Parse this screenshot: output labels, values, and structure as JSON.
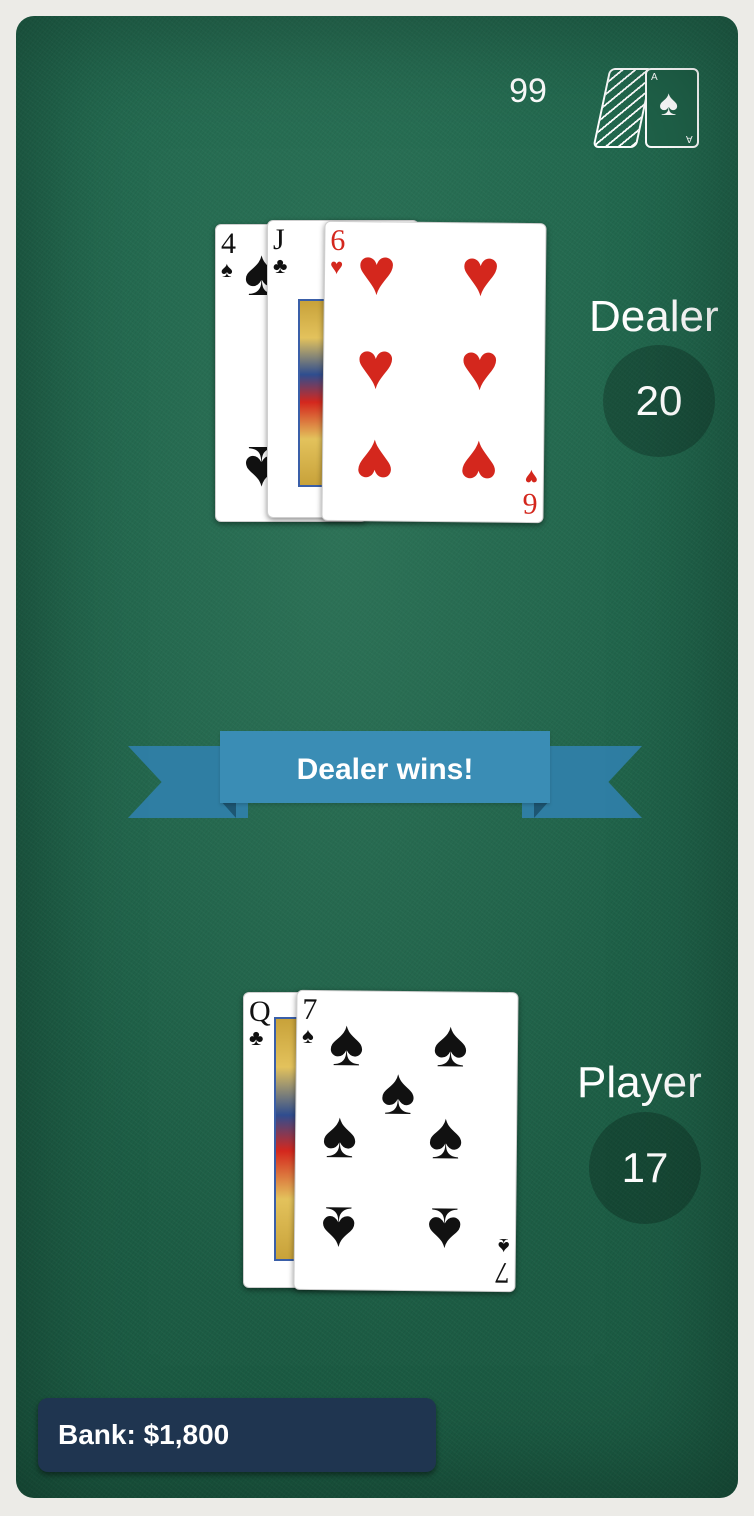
{
  "deck": {
    "remaining": "99",
    "icon": "card-deck-icon"
  },
  "dealer": {
    "label": "Dealer",
    "score": "20",
    "cards": [
      {
        "rank": "4",
        "suit": "♠",
        "color": "black"
      },
      {
        "rank": "J",
        "suit": "♣",
        "color": "black"
      },
      {
        "rank": "6",
        "suit": "♥",
        "color": "red"
      }
    ]
  },
  "player": {
    "label": "Player",
    "score": "17",
    "cards": [
      {
        "rank": "Q",
        "suit": "♣",
        "color": "black"
      },
      {
        "rank": "7",
        "suit": "♠",
        "color": "black"
      }
    ]
  },
  "result": {
    "message": "Dealer wins!"
  },
  "bank": {
    "text": "Bank: $1,800"
  },
  "colors": {
    "felt": "#1f6249",
    "banner": "#3a8db5",
    "bank_panel": "#1f3550",
    "red_suit": "#d4271d"
  }
}
